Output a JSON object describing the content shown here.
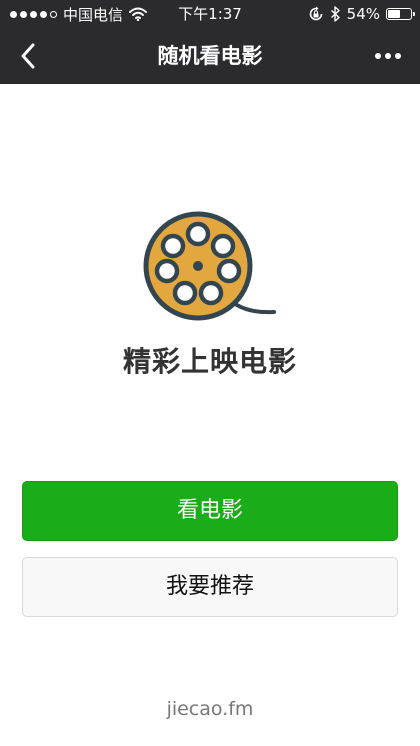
{
  "status_bar": {
    "carrier": "中国电信",
    "time": "下午1:37",
    "battery": "54%",
    "battery_level": 0.54,
    "signal_bars_filled": 4,
    "signal_bars_total": 5
  },
  "nav": {
    "title": "随机看电影",
    "back_icon": "chevron-left-icon",
    "more_icon": "more-dots-icon"
  },
  "hero": {
    "icon": "film-reel-icon",
    "title": "精彩上映电影"
  },
  "actions": {
    "primary_label": "看电影",
    "secondary_label": "我要推荐"
  },
  "footer": {
    "text": "jiecao.fm"
  },
  "colors": {
    "nav_background": "#2b2b2d",
    "primary_button": "#1aad19",
    "reel_fill": "#e2a73e",
    "reel_outline": "#33464f"
  }
}
